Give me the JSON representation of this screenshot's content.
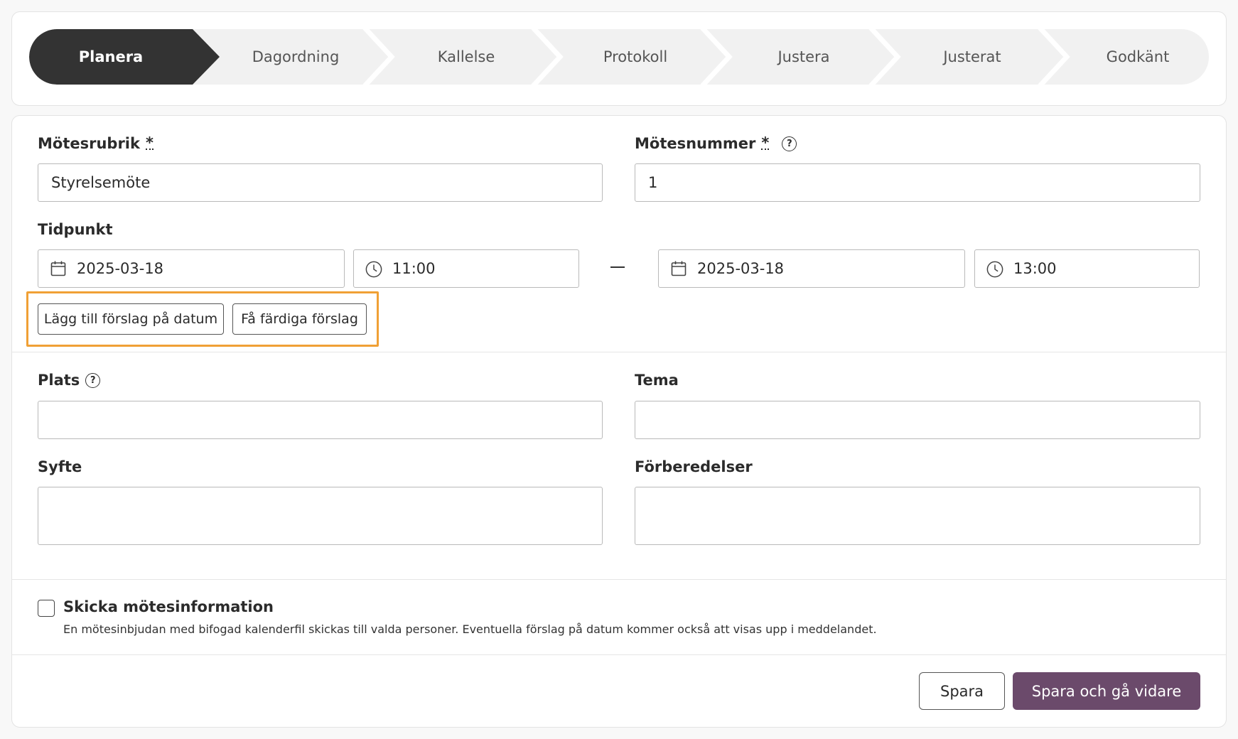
{
  "stepper": {
    "steps": [
      "Planera",
      "Dagordning",
      "Kallelse",
      "Protokoll",
      "Justera",
      "Justerat",
      "Godkänt"
    ],
    "active_index": 0,
    "active_color": "#333333"
  },
  "form": {
    "title_label": "Mötesrubrik",
    "title_value": "Styrelsemöte",
    "number_label": "Mötesnummer",
    "number_value": "1",
    "required_mark": "*",
    "time_label": "Tidpunkt",
    "start_date": "2025-03-18",
    "start_time": "11:00",
    "end_date": "2025-03-18",
    "end_time": "13:00",
    "add_suggestion_button": "Lägg till förslag på datum",
    "get_suggestions_button": "Få färdiga förslag",
    "place_label": "Plats",
    "place_value": "",
    "theme_label": "Tema",
    "theme_value": "",
    "purpose_label": "Syfte",
    "purpose_value": "",
    "preparations_label": "Förberedelser",
    "preparations_value": "",
    "help_glyph": "?"
  },
  "send_info": {
    "label": "Skicka mötesinformation",
    "checked": false,
    "help_text": "En mötesinbjudan med bifogad kalenderfil skickas till valda personer. Eventuella förslag på datum kommer också att visas upp i meddelandet."
  },
  "footer": {
    "save_label": "Spara",
    "save_next_label": "Spara och gå vidare",
    "primary_color": "#6b4a6b"
  },
  "highlight_color": "#f0a035"
}
